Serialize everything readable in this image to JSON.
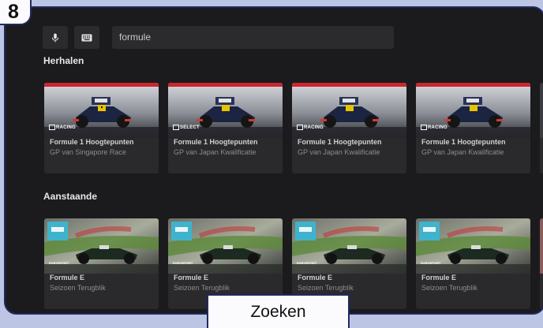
{
  "step_badge": "8",
  "search": {
    "voice_icon": "microphone-icon",
    "keyboard_icon": "keyboard-icon",
    "query": "formule"
  },
  "sections": [
    {
      "title": "Herhalen",
      "cards": [
        {
          "brand": "RACING",
          "title": "Formule 1 Hoogtepunten",
          "subtitle": "GP van Singapore Race"
        },
        {
          "brand": "SELECT",
          "title": "Formule 1 Hoogtepunten",
          "subtitle": "GP van Japan Kwalificatie"
        },
        {
          "brand": "RACING",
          "title": "Formule 1 Hoogtepunten",
          "subtitle": "GP van Japan Kwalificatie"
        },
        {
          "brand": "RACING",
          "title": "Formule 1 Hoogtepunten",
          "subtitle": "GP van Japan Kwalificatie"
        }
      ]
    },
    {
      "title": "Aanstaande",
      "cards": [
        {
          "brand": "EUROSPORT",
          "title": "Formule E",
          "subtitle": "Seizoen Terugblik"
        },
        {
          "brand": "EUROSPORT",
          "title": "Formule E",
          "subtitle": "Seizoen Terugblik"
        },
        {
          "brand": "EUROSPORT",
          "title": "Formule E",
          "subtitle": "Seizoen Terugblik"
        },
        {
          "brand": "EUROSPORT",
          "title": "Formule E",
          "subtitle": "Seizoen Terugblik"
        }
      ]
    }
  ],
  "caption": "Zoeken",
  "colors": {
    "background": "#1b1b1d",
    "card": "#2a2a2d",
    "frame": "#202a5e",
    "outer": "#bcc6e4"
  }
}
